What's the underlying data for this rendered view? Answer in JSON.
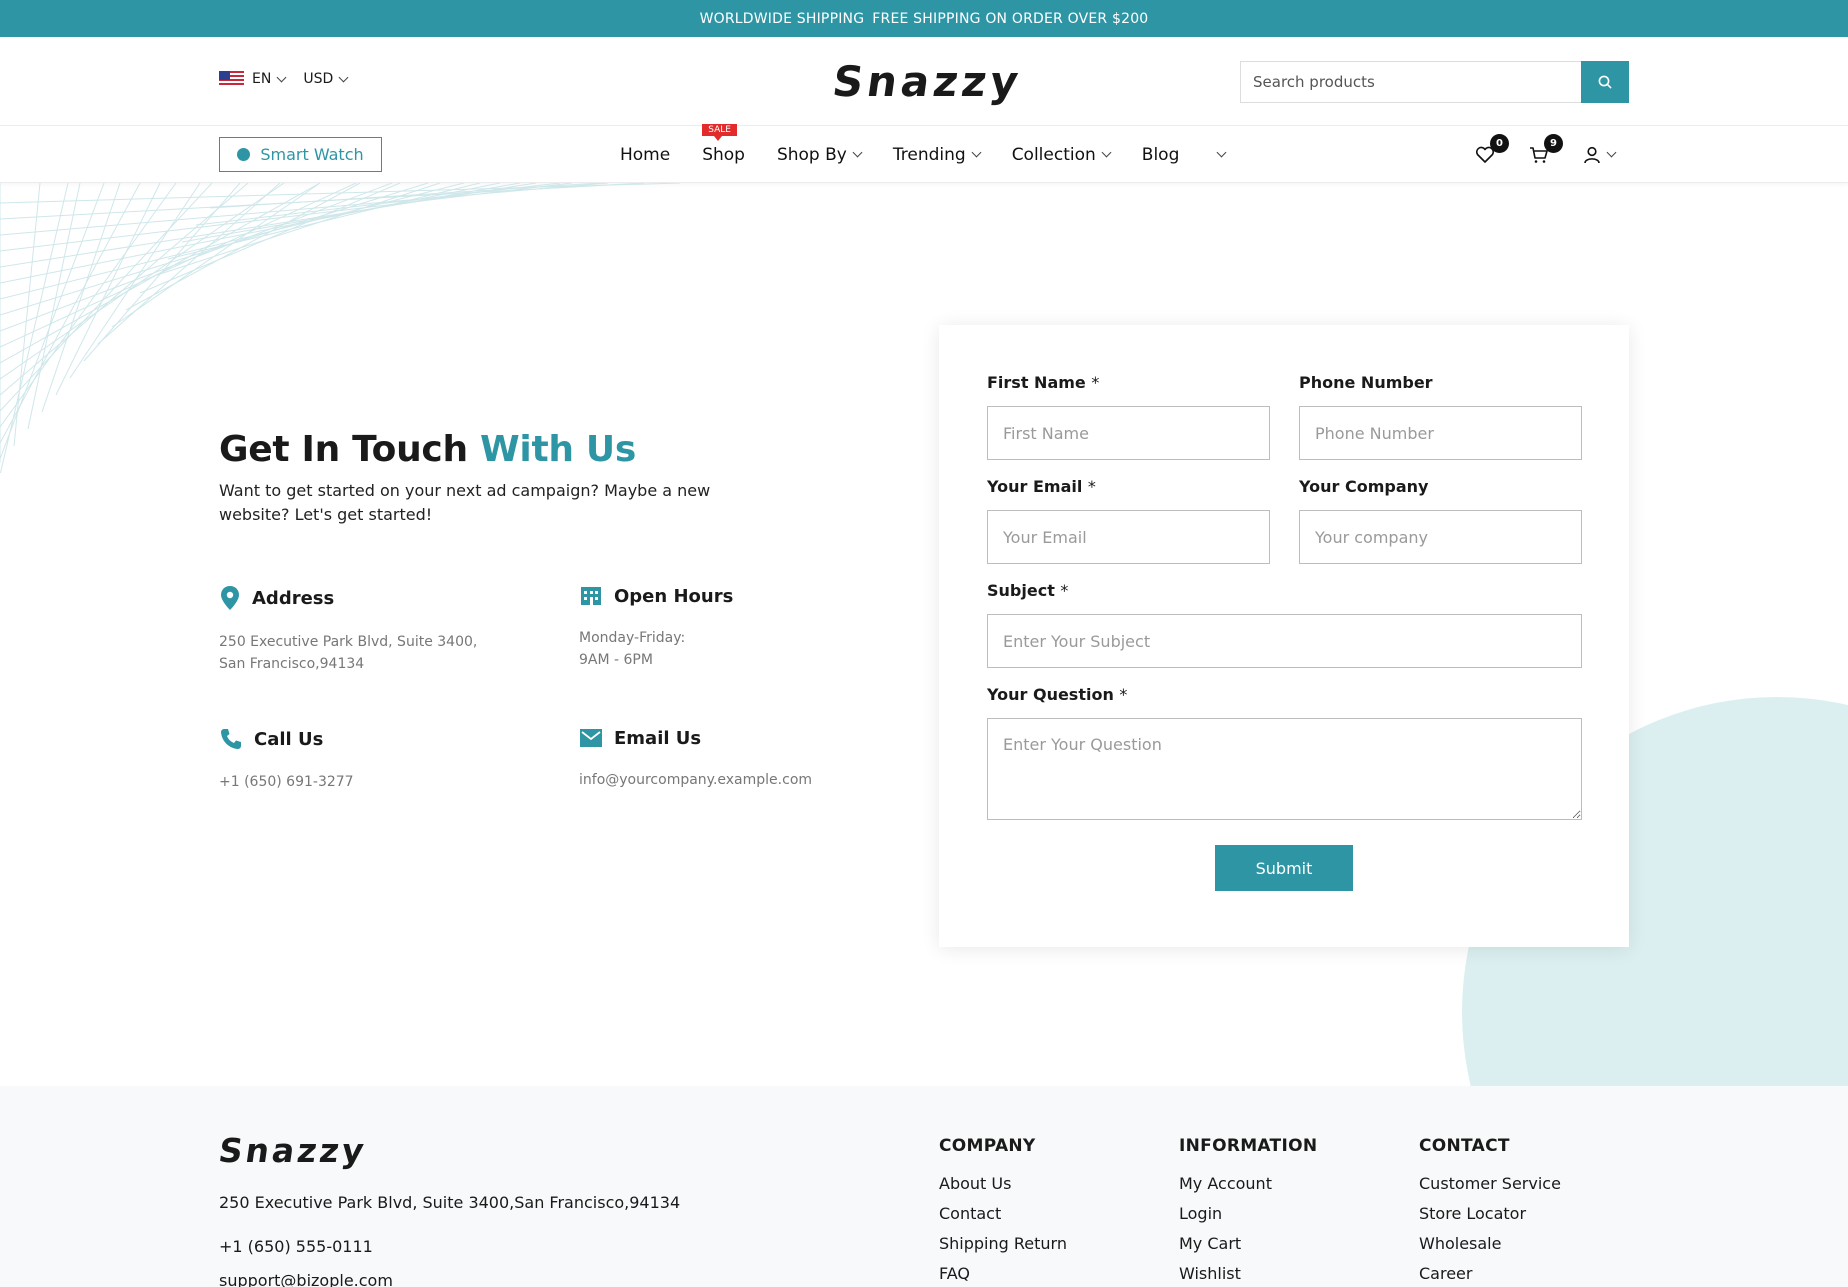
{
  "topbar": {
    "part1": "WORLDWIDE SHIPPING",
    "part2": "FREE SHIPPING ON ORDER OVER $200"
  },
  "header": {
    "language": "EN",
    "currency": "USD",
    "logo": "Snazzy",
    "search_placeholder": "Search products"
  },
  "nav": {
    "promo": "Smart Watch",
    "sale_badge": "SALE",
    "items": [
      "Home",
      "Shop",
      "Shop By",
      "Trending",
      "Collection",
      "Blog"
    ],
    "wishlist_count": "0",
    "cart_count": "9"
  },
  "contact": {
    "heading_main": "Get In Touch",
    "heading_accent": "With Us",
    "subtext": "Want to get started on your next ad campaign? Maybe a new website? Let's get started!",
    "address_title": "Address",
    "address_line1": "250 Executive Park Blvd, Suite 3400,",
    "address_line2": "San Francisco,94134",
    "hours_title": "Open Hours",
    "hours_line1": "Monday-Friday:",
    "hours_line2": "9AM - 6PM",
    "call_title": "Call Us",
    "call_value": "+1 (650) 691-3277",
    "email_title": "Email Us",
    "email_value": "info@yourcompany.example.com"
  },
  "form": {
    "first_name_label": "First Name",
    "first_name_placeholder": "First Name",
    "phone_label": "Phone Number",
    "phone_placeholder": "Phone Number",
    "email_label": "Your Email",
    "email_placeholder": "Your Email",
    "company_label": "Your Company",
    "company_placeholder": "Your company",
    "subject_label": "Subject",
    "subject_placeholder": "Enter Your Subject",
    "question_label": "Your Question",
    "question_placeholder": "Enter Your Question",
    "required_mark": "*",
    "submit": "Submit"
  },
  "footer": {
    "logo": "Snazzy",
    "address": "250 Executive Park Blvd, Suite 3400,San Francisco,94134",
    "phone": "+1 (650) 555-0111",
    "email": "support@bizople.com",
    "columns": [
      {
        "heading": "COMPANY",
        "links": [
          "About Us",
          "Contact",
          "Shipping Return",
          "FAQ"
        ]
      },
      {
        "heading": "INFORMATION",
        "links": [
          "My Account",
          "Login",
          "My Cart",
          "Wishlist"
        ]
      },
      {
        "heading": "CONTACT",
        "links": [
          "Customer Service",
          "Store Locator",
          "Wholesale",
          "Career"
        ]
      }
    ]
  },
  "colors": {
    "accent": "#2e95a5",
    "sale": "#e22c2c",
    "blob": "#dbeff1"
  }
}
